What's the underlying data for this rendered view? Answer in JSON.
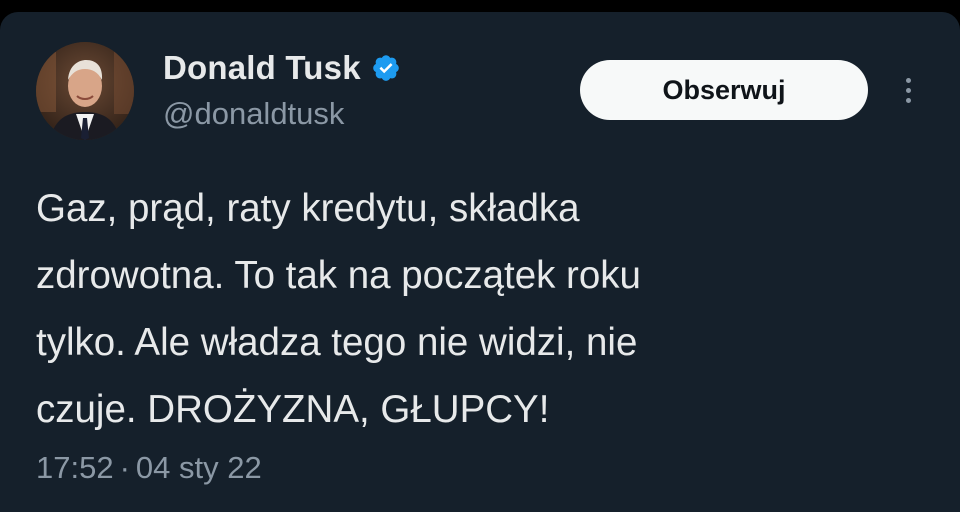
{
  "author": {
    "display_name": "Donald Tusk",
    "handle": "@donaldtusk",
    "verified": true,
    "avatar": "profile-photo"
  },
  "actions": {
    "follow_label": "Obserwuj",
    "more_icon": "more-vertical-icon"
  },
  "tweet": {
    "lines": [
      "Gaz, prąd, raty kredytu, składka",
      "zdrowotna. To tak na początek roku",
      "tylko. Ale władza tego nie widzi, nie",
      "czuje. DROŻYZNA, GŁUPCY!"
    ],
    "time": "17:52",
    "separator": "·",
    "date": "04 sty 22"
  },
  "colors": {
    "background": "#15202b",
    "primary_text": "#e7e9ea",
    "secondary_text": "#8b98a5",
    "verified_badge": "#1d9bf0",
    "follow_button_bg": "#f7f9f9"
  }
}
